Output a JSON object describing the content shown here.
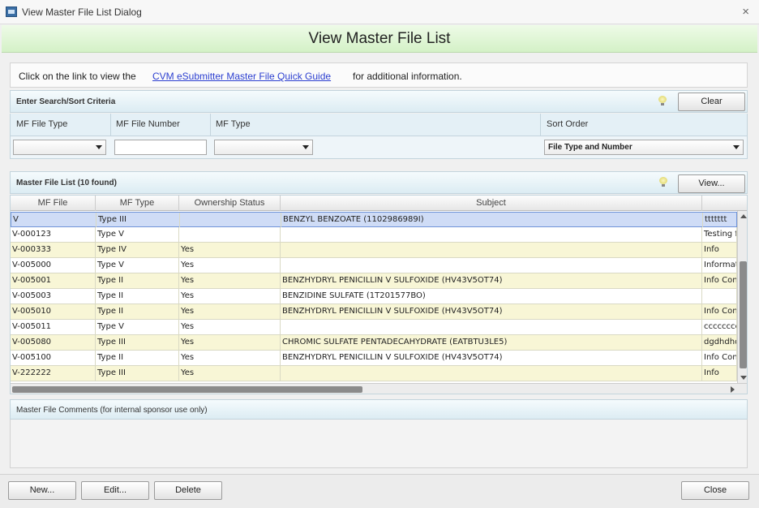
{
  "window": {
    "title": "View Master File List Dialog",
    "close_glyph": "×"
  },
  "header": {
    "heading": "View Master File List"
  },
  "info": {
    "prefix": "Click on the link to view the",
    "link": "CVM eSubmitter Master File Quick Guide",
    "suffix": "for additional information."
  },
  "search": {
    "section_label": "Enter Search/Sort Criteria",
    "clear_label": "Clear",
    "file_type_label": "MF File Type",
    "file_number_label": "MF File Number",
    "mf_type_label": "MF Type",
    "sort_label": "Sort Order",
    "file_type_value": "",
    "file_number_value": "",
    "mf_type_value": "",
    "sort_value": "File Type and Number"
  },
  "list": {
    "section_label": "Master File List (10 found)",
    "view_label": "View...",
    "columns": [
      "MF File",
      "MF Type",
      "Ownership Status",
      "Subject"
    ],
    "rows": [
      {
        "file": "V",
        "type": "Type III",
        "owner": "",
        "subject": "BENZYL BENZOATE (1102986989I)",
        "extra": "ttttttt"
      },
      {
        "file": "V-000123",
        "type": "Type V",
        "owner": "",
        "subject": "",
        "extra": "Testing f"
      },
      {
        "file": "V-000333",
        "type": "Type IV",
        "owner": "Yes",
        "subject": "",
        "extra": "Info"
      },
      {
        "file": "V-005000",
        "type": "Type V",
        "owner": "Yes",
        "subject": "",
        "extra": "Informati"
      },
      {
        "file": "V-005001",
        "type": "Type II",
        "owner": "Yes",
        "subject": "BENZHYDRYL PENICILLIN V SULFOXIDE (HV43V5OT74)",
        "extra": "Info Con"
      },
      {
        "file": "V-005003",
        "type": "Type II",
        "owner": "Yes",
        "subject": "BENZIDINE SULFATE (1T201577BO)",
        "extra": ""
      },
      {
        "file": "V-005010",
        "type": "Type II",
        "owner": "Yes",
        "subject": "BENZHYDRYL PENICILLIN V SULFOXIDE (HV43V5OT74)",
        "extra": "Info Con"
      },
      {
        "file": "V-005011",
        "type": "Type V",
        "owner": "Yes",
        "subject": "",
        "extra": "cccccccc"
      },
      {
        "file": "V-005080",
        "type": "Type III",
        "owner": "Yes",
        "subject": "CHROMIC SULFATE PENTADECAHYDRATE (EATBTU3LE5)",
        "extra": "dgdhdhd"
      },
      {
        "file": "V-005100",
        "type": "Type II",
        "owner": "Yes",
        "subject": "BENZHYDRYL PENICILLIN V SULFOXIDE (HV43V5OT74)",
        "extra": "Info Con"
      },
      {
        "file": "V-222222",
        "type": "Type III",
        "owner": "Yes",
        "subject": "",
        "extra": "Info"
      }
    ]
  },
  "comments": {
    "label": "Master File Comments (for internal sponsor use only)"
  },
  "footer": {
    "new_label": "New...",
    "edit_label": "Edit...",
    "delete_label": "Delete",
    "close_label": "Close"
  }
}
